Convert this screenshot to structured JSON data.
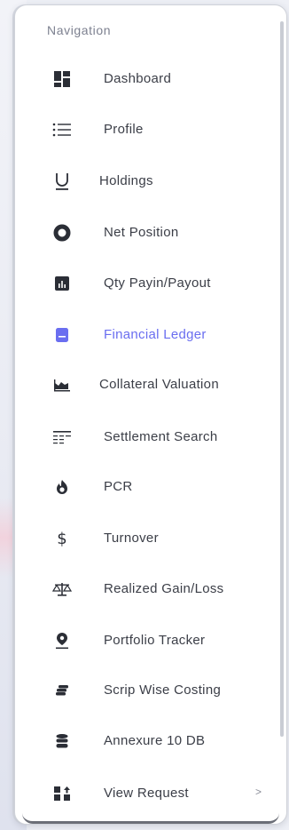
{
  "sidebar": {
    "section_title": "Navigation",
    "items": [
      {
        "label": "Dashboard",
        "icon": "dashboard-grid-icon"
      },
      {
        "label": "Profile",
        "icon": "list-icon"
      },
      {
        "label": "Holdings",
        "icon": "underline-u-icon"
      },
      {
        "label": "Net Position",
        "icon": "ring-icon"
      },
      {
        "label": "Qty Payin/Payout",
        "icon": "bar-chart-square-icon"
      },
      {
        "label": "Financial Ledger",
        "icon": "ledger-icon",
        "active": true
      },
      {
        "label": "Collateral Valuation",
        "icon": "area-chart-icon"
      },
      {
        "label": "Settlement Search",
        "icon": "table-search-icon"
      },
      {
        "label": "PCR",
        "icon": "flame-icon"
      },
      {
        "label": "Turnover",
        "icon": "dollar-icon"
      },
      {
        "label": "Realized Gain/Loss",
        "icon": "scale-icon"
      },
      {
        "label": "Portfolio Tracker",
        "icon": "location-pin-icon"
      },
      {
        "label": "Scrip Wise Costing",
        "icon": "coins-icon"
      },
      {
        "label": "Annexure 10 DB",
        "icon": "database-icon"
      },
      {
        "label": "View Request",
        "icon": "request-icon",
        "has_submenu": true,
        "chevron": ">"
      }
    ]
  },
  "colors": {
    "active": "#6a6ef0",
    "text": "#3b3e47",
    "icon": "#2b2e36",
    "section_title": "#7d8190"
  }
}
